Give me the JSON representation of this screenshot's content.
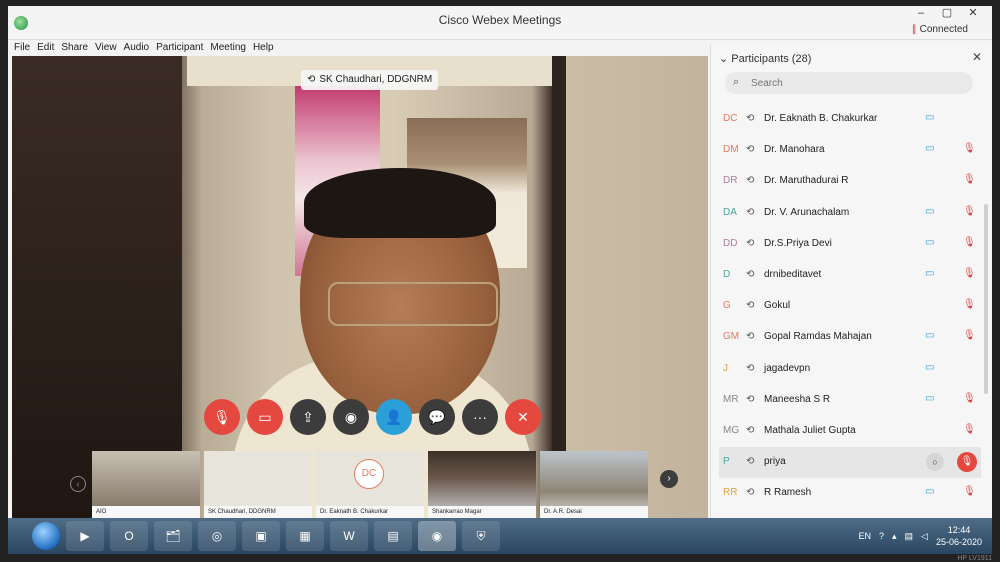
{
  "window": {
    "title": "Cisco Webex Meetings",
    "controls": [
      "–",
      "▢",
      "✕"
    ],
    "status": "Connected"
  },
  "menu": [
    "File",
    "Edit",
    "Share",
    "View",
    "Audio",
    "Participant",
    "Meeting",
    "Help"
  ],
  "video": {
    "active_speaker": "SK Chaudhari, DDGNRM"
  },
  "controls": [
    {
      "name": "mute-button",
      "icon": "mic-off-icon",
      "glyph": "🎙",
      "style": "red"
    },
    {
      "name": "stop-video-button",
      "icon": "camera-off-icon",
      "glyph": "▭",
      "style": "red"
    },
    {
      "name": "share-button",
      "icon": "share-icon",
      "glyph": "⇪",
      "style": "dark"
    },
    {
      "name": "record-button",
      "icon": "record-icon",
      "glyph": "◉",
      "style": "dark"
    },
    {
      "name": "participants-button",
      "icon": "participants-icon",
      "glyph": "👤",
      "style": "blue"
    },
    {
      "name": "chat-button",
      "icon": "chat-icon",
      "glyph": "💬",
      "style": "dark"
    },
    {
      "name": "more-button",
      "icon": "more-icon",
      "glyph": "···",
      "style": "dark"
    },
    {
      "name": "leave-button",
      "icon": "close-icon",
      "glyph": "✕",
      "style": "red"
    }
  ],
  "thumbnails": [
    {
      "label": "AIO",
      "initials": "",
      "style": "v1"
    },
    {
      "label": "SK Chaudhari, DDGNRM",
      "initials": "",
      "style": "v2"
    },
    {
      "label": "Dr. Eaknath B. Chakurkar",
      "initials": "DC",
      "style": "v2"
    },
    {
      "label": "Shankarrao Magar",
      "initials": "",
      "style": "v3"
    },
    {
      "label": "Dr. A.R. Desai",
      "initials": "",
      "style": "v4"
    }
  ],
  "participants": {
    "title": "Participants (28)",
    "search_placeholder": "Search",
    "list": [
      {
        "initials": "DC",
        "name": "Dr. Eaknath B. Chakurkar",
        "video": true,
        "muted": false,
        "color": "#e27a60"
      },
      {
        "initials": "DM",
        "name": "Dr. Manohara",
        "video": true,
        "muted": true,
        "color": "#e27a60"
      },
      {
        "initials": "DR",
        "name": "Dr. Maruthadurai R",
        "video": false,
        "muted": true,
        "color": "#b07c9f"
      },
      {
        "initials": "DA",
        "name": "Dr. V. Arunachalam",
        "video": true,
        "muted": true,
        "color": "#4aa6a0"
      },
      {
        "initials": "DD",
        "name": "Dr.S.Priya Devi",
        "video": true,
        "muted": true,
        "color": "#b07c9f"
      },
      {
        "initials": "D",
        "name": "drnibeditavet",
        "video": true,
        "muted": true,
        "color": "#4aa6a0"
      },
      {
        "initials": "G",
        "name": "Gokul",
        "video": false,
        "muted": true,
        "color": "#e27a60"
      },
      {
        "initials": "GM",
        "name": "Gopal Ramdas Mahajan",
        "video": true,
        "muted": true,
        "color": "#e27a60"
      },
      {
        "initials": "J",
        "name": "jagadevpn",
        "video": true,
        "muted": false,
        "color": "#d9a640"
      },
      {
        "initials": "MR",
        "name": "Maneesha S R",
        "video": true,
        "muted": true,
        "color": "#888888"
      },
      {
        "initials": "MG",
        "name": "Mathala Juliet Gupta",
        "video": false,
        "muted": true,
        "color": "#888888"
      },
      {
        "initials": "P",
        "name": "priya",
        "video": false,
        "muted": true,
        "color": "#4aa6a0",
        "highlight": true
      },
      {
        "initials": "RR",
        "name": "R Ramesh",
        "video": true,
        "muted": true,
        "color": "#d9a640"
      }
    ]
  },
  "taskbar": {
    "apps": [
      "▶",
      "O",
      "🗂",
      "◎",
      "▣",
      "▦",
      "W",
      "▤",
      "◉",
      "⛨"
    ],
    "lang": "EN",
    "time": "12:44",
    "date": "25-06-2020"
  },
  "monitor_brand": "HP LV1911"
}
